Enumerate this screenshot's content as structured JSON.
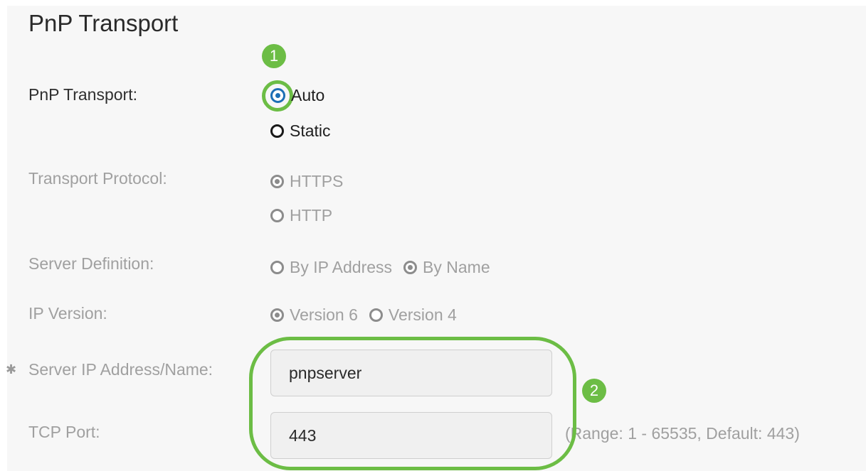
{
  "page": {
    "title": "PnP Transport"
  },
  "form": {
    "pnp_transport": {
      "label": "PnP Transport:",
      "options": [
        "Auto",
        "Static"
      ],
      "selected": "Auto"
    },
    "transport_protocol": {
      "label": "Transport Protocol:",
      "options": [
        "HTTPS",
        "HTTP"
      ],
      "selected": "HTTPS"
    },
    "server_definition": {
      "label": "Server Definition:",
      "options": [
        "By IP Address",
        "By Name"
      ],
      "selected": "By Name"
    },
    "ip_version": {
      "label": "IP Version:",
      "options": [
        "Version 6",
        "Version 4"
      ],
      "selected": "Version 6"
    },
    "server_address": {
      "label": "Server IP Address/Name:",
      "value": "pnpserver"
    },
    "tcp_port": {
      "label": "TCP Port:",
      "value": "443",
      "hint": "(Range: 1 - 65535, Default: 443)"
    }
  },
  "annotations": {
    "step1": "1",
    "step2": "2"
  },
  "icons": {
    "required": "gear-icon"
  },
  "colors": {
    "callout_green": "#6cbd45",
    "radio_blue": "#1d6fb5",
    "disabled_text": "#a0a0a0"
  }
}
